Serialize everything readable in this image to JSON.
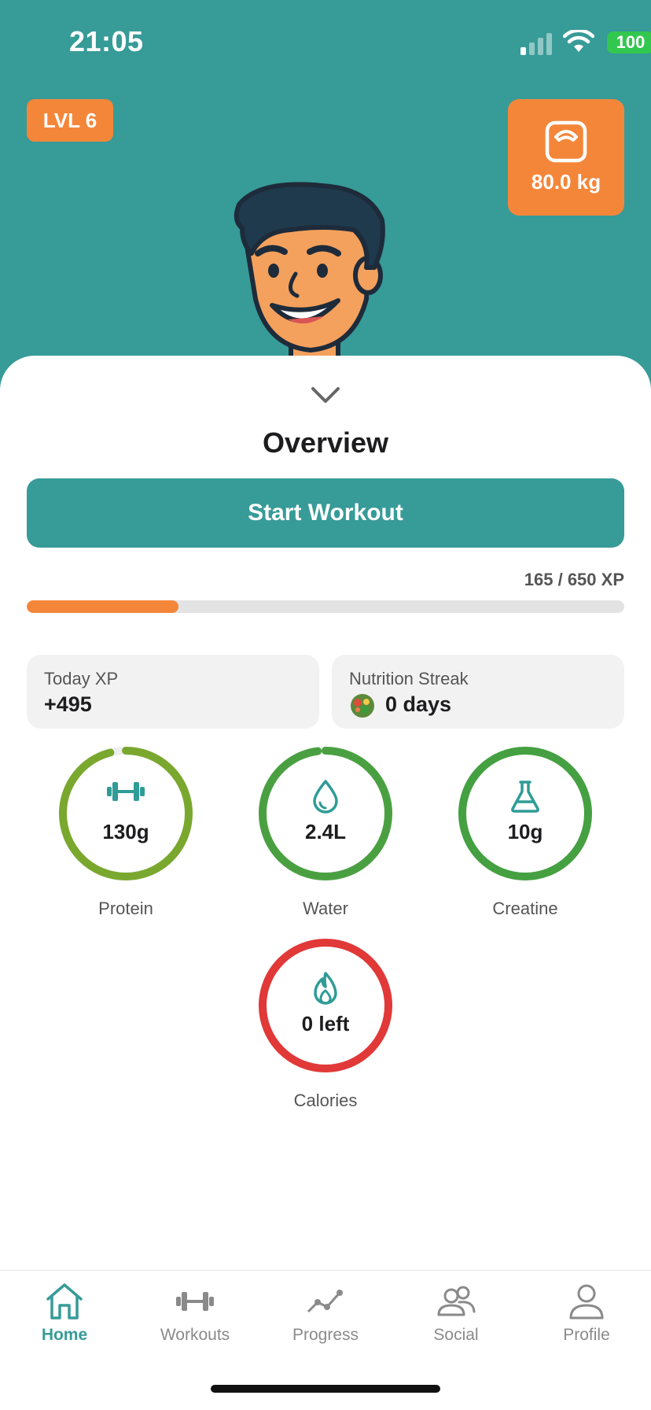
{
  "status_bar": {
    "time": "21:05",
    "battery": "100"
  },
  "header": {
    "level_badge": "LVL 6",
    "weight": "80.0 kg",
    "weight_icon": "scale-icon"
  },
  "overview": {
    "title": "Overview",
    "start_button": "Start Workout",
    "xp_text": "165 / 650 XP",
    "xp_progress": 0.254
  },
  "stats": {
    "today_xp": {
      "label": "Today XP",
      "value": "+495"
    },
    "nutrition_streak": {
      "label": "Nutrition Streak",
      "value": "0 days",
      "icon": "salad-icon"
    }
  },
  "rings": [
    {
      "key": "protein",
      "value": "130g",
      "label": "Protein",
      "icon": "dumbbell-icon",
      "progress": 0.96,
      "color": "#7aa82f"
    },
    {
      "key": "water",
      "value": "2.4L",
      "label": "Water",
      "icon": "droplet-icon",
      "progress": 0.98,
      "color": "#4aa041"
    },
    {
      "key": "creatine",
      "value": "10g",
      "label": "Creatine",
      "icon": "flask-icon",
      "progress": 1.0,
      "color": "#45a041"
    },
    {
      "key": "calories",
      "value": "0 left",
      "label": "Calories",
      "icon": "flame-icon",
      "progress": 1.0,
      "color": "#e13838"
    }
  ],
  "tabbar": {
    "items": [
      {
        "label": "Home",
        "icon": "home-icon",
        "active": true
      },
      {
        "label": "Workouts",
        "icon": "dumbbell-icon",
        "active": false
      },
      {
        "label": "Progress",
        "icon": "trend-icon",
        "active": false
      },
      {
        "label": "Social",
        "icon": "people-icon",
        "active": false
      },
      {
        "label": "Profile",
        "icon": "person-icon",
        "active": false
      }
    ]
  },
  "colors": {
    "brand_teal": "#379b98",
    "accent_orange": "#f4863a",
    "battery_green": "#32c74f"
  }
}
